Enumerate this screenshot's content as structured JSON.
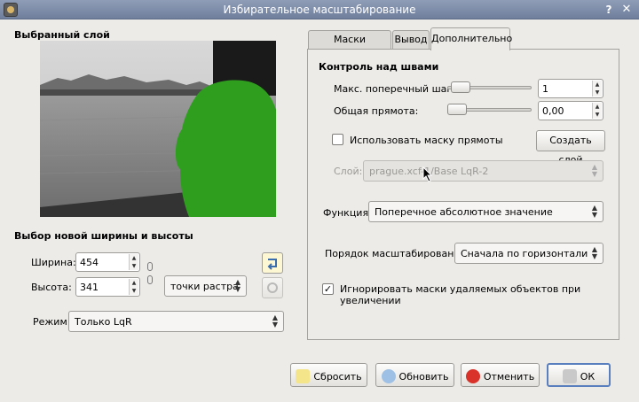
{
  "window": {
    "title": "Избирательное масштабирование"
  },
  "left": {
    "layer_heading": "Выбранный слой",
    "size_heading": "Выбор новой ширины и высоты",
    "width_label": "Ширина:",
    "width_value": "454",
    "height_label": "Высота:",
    "height_value": "341",
    "units_value": "точки растра",
    "mode_label": "Режим:",
    "mode_value": "Только LqR"
  },
  "tabs": [
    "Маски объектов",
    "Вывод",
    "Дополнительно"
  ],
  "active_tab": "Дополнительно",
  "advanced": {
    "seams_heading": "Контроль над швами",
    "max_step_label": "Макс. поперечный шаг:",
    "max_step_value": "1",
    "rigidity_label": "Общая прямота:",
    "rigidity_value": "0,00",
    "use_rigidity_mask_label": "Использовать маску прямоты",
    "use_rigidity_mask_checked": false,
    "create_layer_button": "Создать слой",
    "layer_label": "Слой:",
    "layer_value": "prague.xcf-1/Base LqR-2",
    "function_label": "Функция:",
    "function_value": "Поперечное абсолютное значение",
    "order_label": "Порядок масштабирования:",
    "order_value": "Сначала по горизонтали",
    "ignore_masks_label": "Игнорировать маски удаляемых объектов при увеличении",
    "ignore_masks_checked": true
  },
  "buttons": {
    "reset": "Сбросить",
    "refresh": "Обновить",
    "cancel": "Отменить",
    "ok": "ОК"
  },
  "colors": {
    "mask_green": "#2f9e1f",
    "titlebar": "#7f8eab",
    "ok_border": "#5a7fbf"
  }
}
